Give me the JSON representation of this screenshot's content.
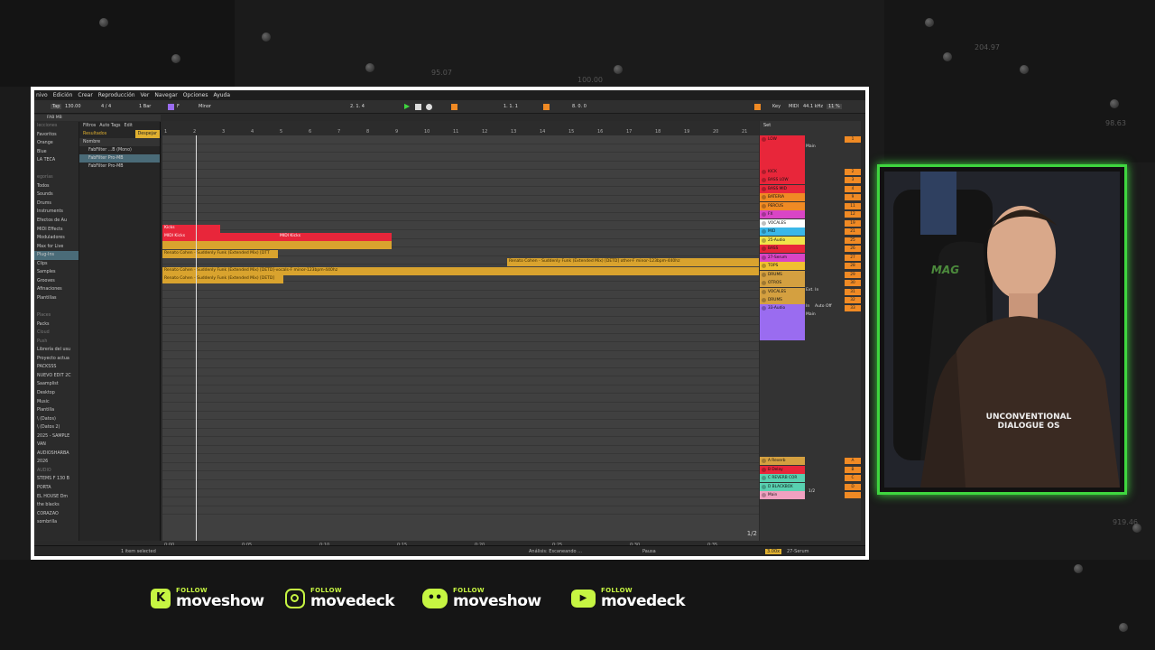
{
  "background": {
    "numbers": [
      "95.07",
      "204.97",
      "100.00",
      "98.63",
      "919.46"
    ]
  },
  "daw": {
    "menu": [
      "nivo",
      "Edición",
      "Crear",
      "Reproducción",
      "Ver",
      "Navegar",
      "Opciones",
      "Ayuda"
    ],
    "transport": {
      "tap": "Tap",
      "tempo": "130.00",
      "signature": "4 / 4",
      "quant": "1 Bar",
      "key": "F",
      "scale": "Minor",
      "position": "2.  1.  4",
      "loop_start": "1.  1.  1",
      "loop_len": "8.  0.  0",
      "key_label": "Key",
      "midi": "MIDI",
      "sample_rate": "44.1 kHz",
      "cpu": "11 %"
    },
    "browser": {
      "search": "FAB MB",
      "items": [
        {
          "label": "lecciones",
          "dim": true
        },
        {
          "label": "Favoritos"
        },
        {
          "label": "Orange"
        },
        {
          "label": "Blue"
        },
        {
          "label": "LA TECA"
        },
        {
          "label": "",
          "dim": true
        },
        {
          "label": "egorías",
          "dim": true
        },
        {
          "label": "Todos"
        },
        {
          "label": "Sounds"
        },
        {
          "label": "Drums"
        },
        {
          "label": "Instruments"
        },
        {
          "label": "Efectos de Au"
        },
        {
          "label": "MIDI Effects"
        },
        {
          "label": "Moduladores"
        },
        {
          "label": "Max for Live"
        },
        {
          "label": "Plug-Ins",
          "sel": true
        },
        {
          "label": "Clips"
        },
        {
          "label": "Samples"
        },
        {
          "label": "Grooves"
        },
        {
          "label": "Afinaciones"
        },
        {
          "label": "Plantillas"
        },
        {
          "label": "",
          "dim": true
        },
        {
          "label": "Places",
          "dim": true
        },
        {
          "label": "Packs"
        },
        {
          "label": "Cloud",
          "dim": true
        },
        {
          "label": "Push",
          "dim": true
        },
        {
          "label": "Librería del usu"
        },
        {
          "label": "Proyecto actua"
        },
        {
          "label": "PACKSSS"
        },
        {
          "label": "NUEVO EDIT 2C"
        },
        {
          "label": "Saamplist"
        },
        {
          "label": "Desktop"
        },
        {
          "label": "Music"
        },
        {
          "label": "Plantilla"
        },
        {
          "label": "\\ (Datos)"
        },
        {
          "label": "\\ (Datos 2)"
        },
        {
          "label": "2025 - SAMPLE"
        },
        {
          "label": "VAN"
        },
        {
          "label": "AUDIOSHARBA"
        },
        {
          "label": "2026"
        },
        {
          "label": "AUDIO",
          "dim": true
        },
        {
          "label": "STEMS F 130 B"
        },
        {
          "label": "PORTA"
        },
        {
          "label": "EL HOUSE Dm"
        },
        {
          "label": "the blacks"
        },
        {
          "label": "CORAZAO"
        },
        {
          "label": "sombrilla"
        }
      ],
      "filters": "Filtros",
      "auto_tags": "Auto Tags",
      "edit": "Edit",
      "results": "Resultados",
      "clear": "Despejar",
      "name_col": "Nombre",
      "files": [
        "FabFilter ...B (Mono)",
        "FabFilter Pro-MB",
        "FabFilter Pro-MB"
      ],
      "status": "1 item selected"
    },
    "ruler": [
      "1",
      "2",
      "3",
      "4",
      "5",
      "6",
      "7",
      "8",
      "9",
      "10",
      "11",
      "12",
      "13",
      "14",
      "15",
      "16",
      "17",
      "18",
      "19",
      "20",
      "21"
    ],
    "clips": {
      "c1": "Kicks",
      "c2": "MIDI Kicks",
      "c3": "MIDI Kicks",
      "c4": "Renato Cohen - Suddenly Funk (Extended Mix) [DTT",
      "c5": "Renato Cohen - Suddenly Funk (Extended Mix) [DETD] other-F minor-123bpm-440hz",
      "c6": "Renato Cohen - Suddenly Funk (Extended Mix) [DETD]-vocals-F minor-123bpm-440hz",
      "c7": "Renato Cohen - Suddenly Funk (Extended Mix) [DETD]"
    },
    "timeline": [
      "0:00",
      "0:05",
      "0:10",
      "0:15",
      "0:20",
      "0:25",
      "0:30",
      "0:35"
    ],
    "page_indicator": "1/2",
    "tracks": [
      {
        "name": "LOW",
        "num": "1",
        "color": "#e8263a"
      },
      {
        "name": "KICK",
        "num": "2",
        "color": "#e8263a"
      },
      {
        "name": "BASS LOW",
        "num": "3",
        "color": "#e8263a"
      },
      {
        "name": "BASS MID",
        "num": "4",
        "color": "#e8263a"
      },
      {
        "name": "BATERIA",
        "num": "9",
        "color": "#f08a24"
      },
      {
        "name": "PERCUS",
        "num": "11",
        "color": "#f08a24"
      },
      {
        "name": "FX",
        "num": "12",
        "color": "#d945c6"
      },
      {
        "name": "VOCALES",
        "num": "19",
        "color": "#ffffff"
      },
      {
        "name": "MID",
        "num": "21",
        "color": "#3ab7e8"
      },
      {
        "name": "25-Audio",
        "num": "25",
        "color": "#f0e34a"
      },
      {
        "name": "BASS",
        "num": "26",
        "color": "#e8263a"
      },
      {
        "name": "27-Serum",
        "num": "27",
        "color": "#d945c6"
      },
      {
        "name": "TOPS",
        "num": "28",
        "color": "#f0c030"
      },
      {
        "name": "DRUMS",
        "num": "29",
        "color": "#d4a040"
      },
      {
        "name": "OTROS",
        "num": "30",
        "color": "#d4a040"
      },
      {
        "name": "VOCALES",
        "num": "31",
        "color": "#d4a040"
      },
      {
        "name": "DRUMS",
        "num": "32",
        "color": "#d4a040"
      },
      {
        "name": "33-Audio",
        "num": "33",
        "color": "#9a6cf0"
      }
    ],
    "returns": [
      {
        "name": "A Reverb",
        "num": "A",
        "color": "#d4a040"
      },
      {
        "name": "B Delay",
        "num": "B",
        "color": "#e8263a"
      },
      {
        "name": "C REVERB COR",
        "num": "C",
        "color": "#58d0b0"
      },
      {
        "name": "D BLACKBOX",
        "num": "D",
        "color": "#58d0b0"
      },
      {
        "name": "Main",
        "num": "",
        "color": "#f0a0c0"
      }
    ],
    "mixer": {
      "main": "Main",
      "ext_in": "Ext. In",
      "auto": "Auto",
      "off": "Off",
      "in": "In",
      "set": "Set",
      "half": "1/2"
    },
    "status": {
      "analysis": "Análisis: Escaneando ...",
      "pause": "Pausa",
      "device": "27-Serum",
      "zoom": "3.00x"
    }
  },
  "socials": [
    {
      "platform": "kick-icon",
      "follow": "FOLLOW",
      "handle": "moveshow"
    },
    {
      "platform": "instagram-icon",
      "follow": "FOLLOW",
      "handle": "movedeck"
    },
    {
      "platform": "discord-icon",
      "follow": "FOLLOW",
      "handle": "moveshow"
    },
    {
      "platform": "youtube-icon",
      "follow": "FOLLOW",
      "handle": "movedeck"
    }
  ],
  "camera": {
    "shirt_text": "UNCONVENTIONAL DIALOGUE OS",
    "chair_text": "MAG"
  }
}
